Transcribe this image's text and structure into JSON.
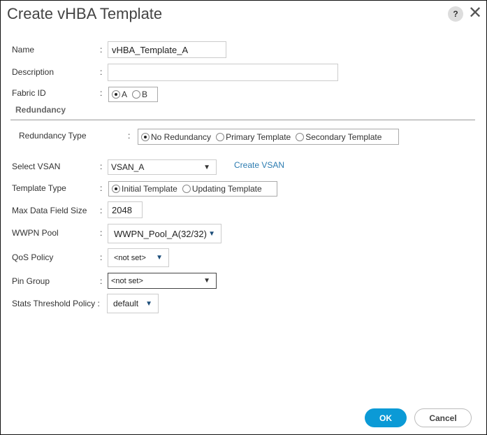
{
  "dialog": {
    "title": "Create vHBA Template",
    "help": "?",
    "close": "✕"
  },
  "form": {
    "name": {
      "label": "Name",
      "value": "vHBA_Template_A"
    },
    "description": {
      "label": "Description",
      "value": ""
    },
    "fabric_id": {
      "label": "Fabric ID",
      "options": [
        "A",
        "B"
      ],
      "selected": "A"
    },
    "redundancy_section": "Redundancy",
    "redundancy_type": {
      "label": "Redundancy Type",
      "options": [
        "No Redundancy",
        "Primary Template",
        "Secondary Template"
      ],
      "selected": "No Redundancy"
    },
    "select_vsan": {
      "label": "Select VSAN",
      "value": "VSAN_A",
      "link": "Create VSAN"
    },
    "template_type": {
      "label": "Template Type",
      "options": [
        "Initial Template",
        "Updating Template"
      ],
      "selected": "Initial Template"
    },
    "max_data_field_size": {
      "label": "Max Data Field Size",
      "value": "2048"
    },
    "wwpn_pool": {
      "label": "WWPN Pool",
      "value": "WWPN_Pool_A(32/32)"
    },
    "qos_policy": {
      "label": "QoS Policy",
      "value": "<not set>"
    },
    "pin_group": {
      "label": "Pin Group",
      "value": "<not set>"
    },
    "stats_threshold_policy": {
      "label": "Stats Threshold Policy",
      "value": "default"
    },
    "colon": ":"
  },
  "buttons": {
    "ok": "OK",
    "cancel": "Cancel"
  }
}
